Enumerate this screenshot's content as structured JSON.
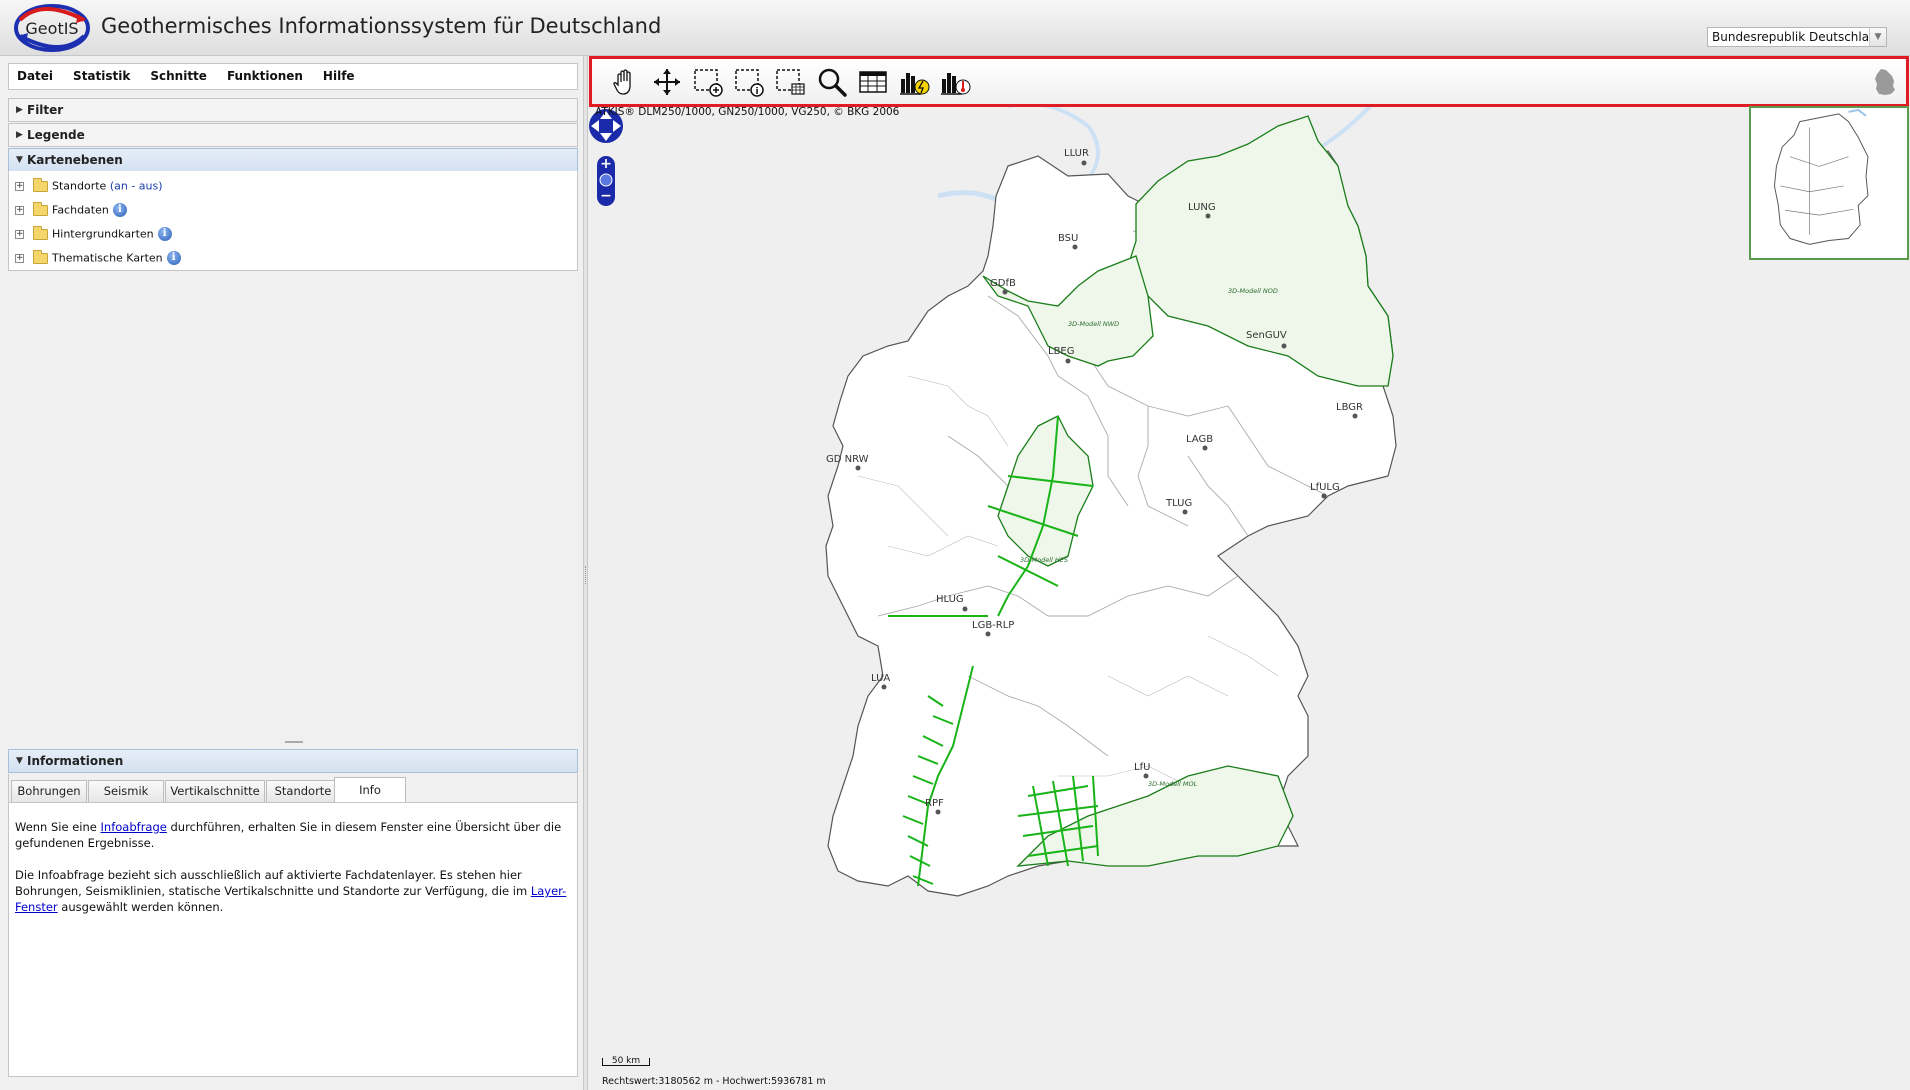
{
  "header": {
    "logo_text": "GeotIS",
    "title": "Geothermisches Informationssystem für Deutschland",
    "region_select": "Bundesrepublik Deutschland"
  },
  "menu": {
    "items": [
      "Datei",
      "Statistik",
      "Schnitte",
      "Funktionen",
      "Hilfe"
    ]
  },
  "accordion": {
    "filter": "Filter",
    "legende": "Legende",
    "kartenebenen": "Kartenebenen"
  },
  "layers": [
    {
      "label": "Standorte",
      "extra": "(an - aus)"
    },
    {
      "label": "Fachdaten"
    },
    {
      "label": "Hintergrundkarten"
    },
    {
      "label": "Thematische Karten"
    }
  ],
  "info": {
    "title": "Informationen",
    "tabs": [
      "Bohrungen",
      "Seismik",
      "Vertikalschnitte",
      "Standorte",
      "Info"
    ],
    "active_tab": "Info",
    "p1_pre": "Wenn Sie eine ",
    "p1_link": "Infoabfrage",
    "p1_post": " durchführen, erhalten Sie in diesem Fenster eine Übersicht über die gefundenen Ergebnisse.",
    "p2_pre": "Die Infoabfrage bezieht sich ausschließlich auf aktivierte Fachdatenlayer. Es stehen hier Bohrungen, Seismiklinien, statische Vertikalschnitte und Standorte zur Verfügung, die im ",
    "p2_link": "Layer-Fenster",
    "p2_post": " ausgewählt werden können."
  },
  "toolbar": {
    "tools": [
      "pan-tool",
      "zoom-full-extent",
      "zoom-box-in",
      "info-box",
      "table-box",
      "search",
      "table-view",
      "statistic-power",
      "statistic-temperature"
    ]
  },
  "map": {
    "attribution": "ATKIS® DLM250/1000, GN250/1000, VG250, © BKG 2006",
    "scale_label": "50 km",
    "coords": "Rechtswert:3180562 m - Hochwert:5936781 m",
    "model_labels": [
      "3D-Modell NOD",
      "3D-Modell NWD",
      "3D-Modell HES",
      "3D-Modell MOL"
    ],
    "locations": [
      "LLUR",
      "LUNG",
      "BSU",
      "GD NRW",
      "LBEG",
      "SenGUV",
      "LBGR",
      "LAGB",
      "LfULG",
      "TLUG",
      "GDfB",
      "HLUG",
      "LGB-RLP",
      "LUA",
      "LfU",
      "RPF"
    ],
    "colors": {
      "border": "#555555",
      "model_fill": "#eef7ea",
      "model_line": "#1a7d1a",
      "seismic": "#18b418",
      "water": "#cde1f5",
      "nav": "#1a2aa8"
    }
  }
}
